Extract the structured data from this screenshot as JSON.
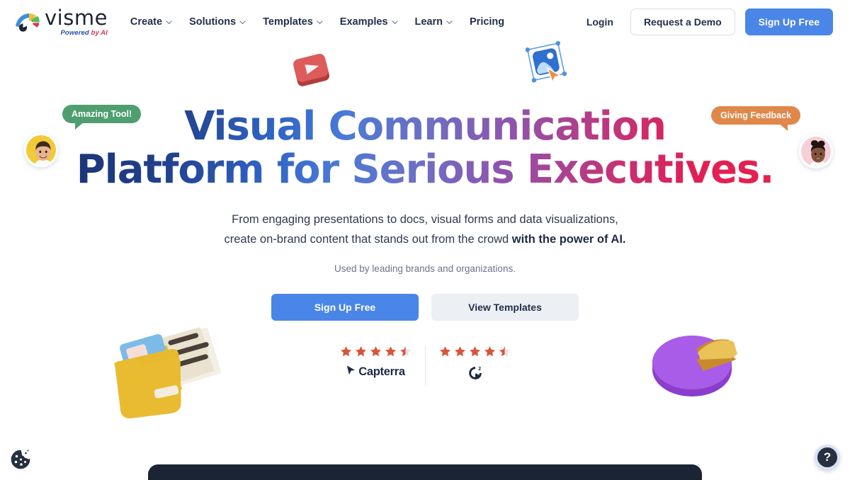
{
  "brand": {
    "name": "visme",
    "tagline_part1": "Powered",
    "tagline_part2": "by AI",
    "logo_icon": "visme-fan-logo-icon",
    "colors": {
      "blue": "#3c8fd8",
      "yellow": "#f0c130",
      "green": "#5cb85c",
      "red": "#e0324f",
      "dark": "#1d2433"
    }
  },
  "nav": {
    "items": [
      {
        "label": "Create",
        "has_dropdown": true
      },
      {
        "label": "Solutions",
        "has_dropdown": true
      },
      {
        "label": "Templates",
        "has_dropdown": true
      },
      {
        "label": "Examples",
        "has_dropdown": true
      },
      {
        "label": "Learn",
        "has_dropdown": true
      },
      {
        "label": "Pricing",
        "has_dropdown": false
      }
    ],
    "login_label": "Login",
    "demo_label": "Request a Demo",
    "signup_label": "Sign Up Free"
  },
  "hero": {
    "headline_line1": "Visual Communication",
    "headline_line2": "Platform for Serious Executives.",
    "headline_gradient": [
      "#1b3477",
      "#2f63c4",
      "#6d6fc4",
      "#9152ab",
      "#e5214f"
    ],
    "sub_line1": "From engaging presentations to docs, visual forms and data visualizations,",
    "sub_line2_normal": "create on-brand content that stands out from the crowd ",
    "sub_line2_bold": "with the power of AI.",
    "used_by": "Used by leading brands and organizations.",
    "cta_primary": "Sign Up Free",
    "cta_secondary": "View Templates",
    "cta_primary_color": "#4a86e8",
    "cta_secondary_color": "#eceff3"
  },
  "ratings": [
    {
      "name": "Capterra",
      "stars": 4.5,
      "star_color": "#d9543a",
      "logo_icon": "capterra-cursor-icon"
    },
    {
      "name": "G2",
      "stars": 4.5,
      "star_color": "#d9543a",
      "logo_icon": "g2-logo-icon"
    }
  ],
  "testimonials": {
    "left": {
      "bubble_text": "Amazing Tool!",
      "bubble_color": "#4e9e6f",
      "avatar_icon": "avatar-man-icon",
      "avatar_bg": "#f2c938"
    },
    "right": {
      "bubble_text": "Giving Feedback",
      "bubble_color": "#e0884a",
      "avatar_icon": "avatar-woman-icon",
      "avatar_bg": "#f6cfd8"
    }
  },
  "decorations": [
    {
      "name": "play-button-3d-icon",
      "color": "#d8504f"
    },
    {
      "name": "image-select-3d-icon",
      "color": "#2f6fd0"
    },
    {
      "name": "folder-documents-3d-icon",
      "color": "#e8b92e"
    },
    {
      "name": "pie-chart-3d-icon",
      "color": "#a358e8"
    }
  ],
  "widgets": {
    "cookie_icon": "cookie-consent-icon",
    "help_label": "?",
    "help_icon": "help-question-icon"
  }
}
